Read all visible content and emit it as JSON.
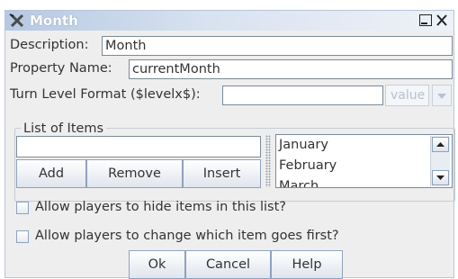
{
  "window": {
    "title": "Month",
    "title_icon": "crossed-tools-icon",
    "minimize_icon": "minimize-icon",
    "close_icon": "close-icon"
  },
  "description": {
    "label": "Description:",
    "value": "Month"
  },
  "property_name": {
    "label": "Property Name:",
    "value": "currentMonth"
  },
  "turn_level_format": {
    "label": "Turn Level Format ($levelx$):",
    "value": "",
    "combo_value": "value",
    "combo_arrow_icon": "chevron-down-icon"
  },
  "list_of_items": {
    "legend": "List of Items",
    "new_item_value": "",
    "add_label": "Add",
    "remove_label": "Remove",
    "insert_label": "Insert",
    "items": [
      "January",
      "February",
      "March"
    ],
    "scroll_up_icon": "arrow-up-icon",
    "scroll_down_icon": "arrow-down-icon"
  },
  "options": {
    "allow_hide": "Allow players to hide items in this list?",
    "allow_change_first": "Allow players to change which item goes first?"
  },
  "buttons": {
    "ok": "Ok",
    "cancel": "Cancel",
    "help": "Help"
  },
  "colors": {
    "titlebar": "#b6c8e2",
    "background": "#eeeeee",
    "border": "#8ea2bd"
  }
}
